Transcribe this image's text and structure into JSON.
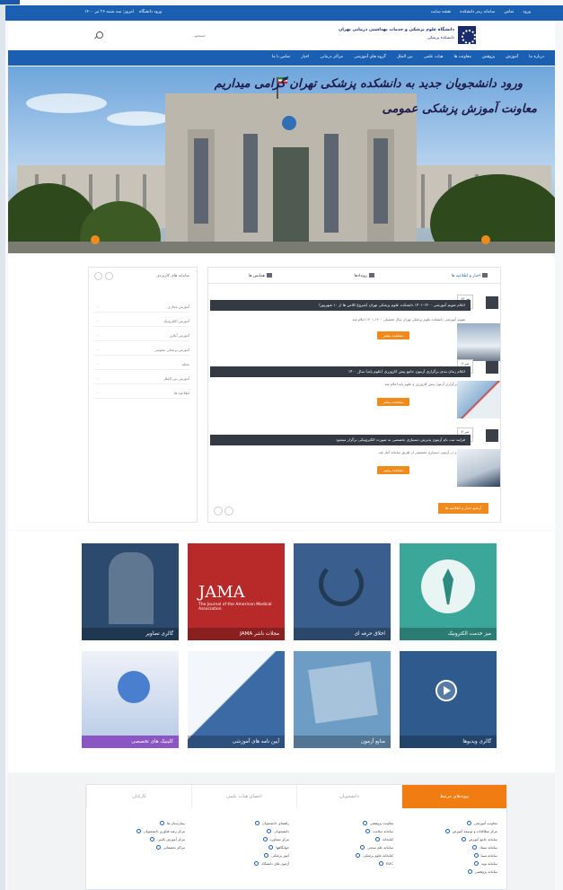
{
  "topbar": {
    "links": [
      "ورود",
      "تماس",
      "سامانه رمز دانشکده",
      "نقشه سایت"
    ],
    "date": "امروز: سه شنبه ۲۶ تیر ۱۴۰۰",
    "visitor_label": "ورود دانشگاه"
  },
  "header": {
    "uni_name": "دانشگاه علوم پزشکی و خدمات بهداشتی درمانی تهران",
    "uni_sub": "دانشکده پزشکی",
    "search_placeholder": "جستجو..."
  },
  "nav": {
    "items": [
      "درباره ما",
      "آموزش",
      "پژوهش",
      "معاونت ها",
      "هیات علمی",
      "بین الملل",
      "گروه های آموزشی",
      "مراکز درمانی",
      "اخبار",
      "تماس با ما"
    ]
  },
  "hero": {
    "line1": "ورود دانشجویان جدید به دانشکده پزشکی تهران گرامی میداریم",
    "line2": "معاونت آموزش پزشکی عمومی"
  },
  "news": {
    "tabs": [
      "اخبار و اطلاعیه ها",
      "رویدادها",
      "همایش ها"
    ],
    "items": [
      {
        "day": "۱۳",
        "month": "تیر",
        "year": "۱۴۰۰",
        "title": "اعلام تقویم آموزشی ۱۴۰۰-۱۴۰۱ دانشکده علوم پزشکی تهران (شروع کلاس ها از ۱۰ شهریور)",
        "desc": "تقویم آموزشی دانشکده علوم پزشکی تهران سال تحصیلی ۱۴۰۰-۱۴۰۱ اعلام شد",
        "button": "مشاهده بیشتر"
      },
      {
        "day": "۶",
        "month": "تیر",
        "year": "۱۴۰۰",
        "title": "اعلام زمان بندی برگزاری آزمون جامع پیش کارورزی (علوم پایه) سال ۱۴۰۰",
        "desc": "زمان برگزاری آزمون پیش کارورزی و علوم پایه اعلام شد",
        "button": "مشاهده بیشتر"
      },
      {
        "day": "۴",
        "month": "تیر",
        "year": "۱۴۰۰",
        "title": "فرایند ثبت نام آزمون پذیرش دستیاری تخصصی به صورت الکترونیکی برگزار میشود",
        "desc": "ثبت نام در آزمون دستیاری تخصصی از طریق سامانه آغاز شد",
        "button": "مشاهده بیشتر"
      }
    ],
    "all_button": "آرشیو اخبار و اطلاعیه ها"
  },
  "sidebar": {
    "title": "سامانه های کاربردی",
    "items": [
      "آموزش مجازی",
      "آموزش الکترونیک",
      "آموزش آنلاین",
      "آموزش پزشکی عمومی",
      "مجله",
      "آموزش بین الملل",
      "اطلاعیه ها"
    ]
  },
  "tiles": [
    {
      "label": "میز خدمت الکترونیک",
      "color": "#3aa79a"
    },
    {
      "label": "اخلاق حرفه ای",
      "color": "#3a5f8e"
    },
    {
      "label": "مجلات ناشر JAMA",
      "color": "#b82a2a"
    },
    {
      "label": "گالری تصاویر",
      "color": "#2b4a6e"
    },
    {
      "label": "گالری ویدیوها",
      "color": "#2e5a8e"
    },
    {
      "label": "منابع آزمون",
      "color": "#6d9cc4"
    },
    {
      "label": "آیین نامه های آموزشی",
      "color": "#3b6aa5"
    },
    {
      "label": "کلینیک های تخصصی",
      "color": "#6a4ea6"
    }
  ],
  "tile_extra": {
    "jama_big": "JAMA",
    "jama_sub": "The Journal of the American Medical Association"
  },
  "bottom": {
    "tabs": [
      "پیوندهای مرتبط",
      "دانشجویان",
      "اعضای هیات علمی",
      "کارکنان"
    ],
    "col1": [
      "معاونت آموزشی",
      "مرکز مطالعات و توسعه آموزش",
      "سامانه جامع آموزش",
      "سامانه سماد",
      "سامانه سیبا",
      "سامانه نوید",
      "سامانه پژوهشی"
    ],
    "col2": [
      "معاونت پژوهشی",
      "سامانه سلامت",
      "کتابخانه",
      "سامانه علم سنجی",
      "کتابخانه علوم پزشکی",
      "EDC"
    ],
    "col3": [
      "راهنمای دانشجویان",
      "دانشجویان",
      "مرکز مشاوره",
      "خوابگاهها",
      "امور پزشکی",
      "آزمون های دانشگاه"
    ],
    "col4": [
      "بیمارستان ها",
      "مرکز رشد فناوری دانشجویان",
      "مرکز آموزش بالینی",
      "مراکز تحقیقاتی"
    ]
  }
}
